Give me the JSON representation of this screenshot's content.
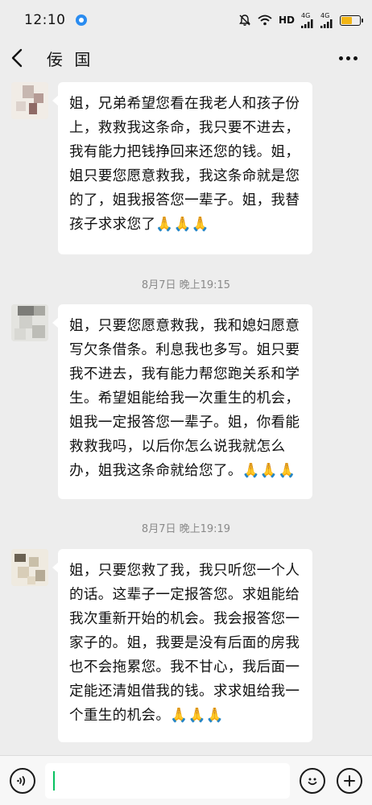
{
  "status_bar": {
    "time": "12:10",
    "network": "HD",
    "signal_1": "4G",
    "signal_2": "4G"
  },
  "nav": {
    "title": "佞   国",
    "back_icon": "chevron-left-icon",
    "more_icon": "more-dots-icon"
  },
  "messages": [
    {
      "text": "姐，兄弟希望您看在我老人和孩子份上，救救我这条命，我只要不进去，我有能力把钱挣回来还您的钱。姐，姐只要您愿意救我，我这条命就是您的了，姐我报答您一辈子。姐，我替孩子求求您了🙏🙏🙏"
    },
    {
      "text": "姐，只要您愿意救我，我和媳妇愿意写欠条借条。利息我也多写。姐只要我不进去，我有能力帮您跑关系和学生。希望姐能给我一次重生的机会，姐我一定报答您一辈子。姐，你看能救救我吗，以后你怎么说我就怎么办，姐我这条命就给您了。🙏🙏🙏"
    },
    {
      "text": "姐，只要您救了我，我只听您一个人的话。这辈子一定报答您。求姐能给我次重新开始的机会。我会报答您一家子的。姐，我要是没有后面的房我也不会拖累您。我不甘心，我后面一定能还清姐借我的钱。求求姐给我一个重生的机会。🙏🙏🙏"
    }
  ],
  "timestamps": [
    "8月7日 晚上19:15",
    "8月7日 晚上19:19"
  ],
  "input_bar": {
    "voice_icon": "voice-icon",
    "emoji_icon": "emoji-icon",
    "plus_icon": "plus-icon",
    "value": ""
  },
  "colors": {
    "background": "#ededed",
    "bubble": "#ffffff",
    "caret": "#07c160",
    "battery": "#f2b515"
  }
}
